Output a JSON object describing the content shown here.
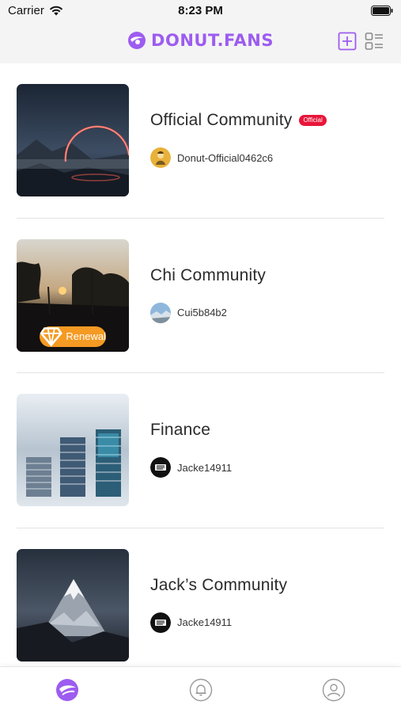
{
  "status_bar": {
    "carrier": "Carrier",
    "time": "8:23 PM"
  },
  "header": {
    "brand": "DONUT.FANS",
    "accent": "#9d5cf0"
  },
  "communities": [
    {
      "title": "Official Community",
      "badge": "Official",
      "owner": "Donut-Official0462c6",
      "thumb_icon": "portal-landscape",
      "avatar_icon": "yellow-character"
    },
    {
      "title": "Chi Community",
      "renewal": "Renewal",
      "owner": "Cui5b84b2",
      "thumb_icon": "sunset-trees",
      "avatar_icon": "sky-landscape"
    },
    {
      "title": "Finance",
      "owner": "Jacke14911",
      "thumb_icon": "coin-stacks",
      "avatar_icon": "jack-logo"
    },
    {
      "title": "Jack’s Community",
      "owner": "Jacke14911",
      "thumb_icon": "snow-mountain",
      "avatar_icon": "jack-logo"
    }
  ],
  "tabbar": {
    "items": [
      {
        "icon": "donut-icon",
        "active": true
      },
      {
        "icon": "bell-icon",
        "active": false
      },
      {
        "icon": "profile-icon",
        "active": false
      }
    ]
  }
}
